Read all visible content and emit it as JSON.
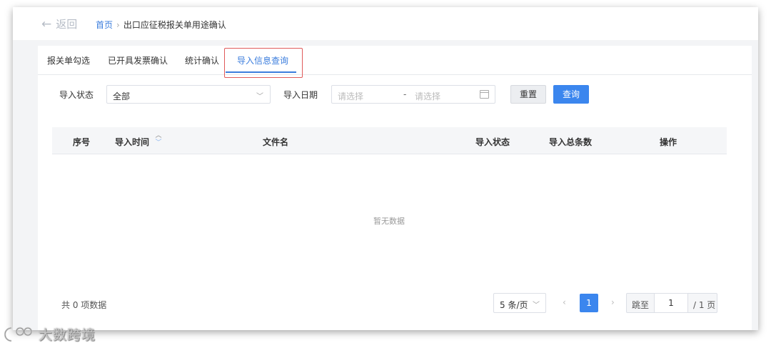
{
  "header": {
    "back_label": "返回",
    "breadcrumb": {
      "home": "首页",
      "separator": "›",
      "current": "出口应征税报关单用途确认"
    }
  },
  "tabs": [
    {
      "label": "报关单勾选"
    },
    {
      "label": "已开具发票确认"
    },
    {
      "label": "统计确认"
    },
    {
      "label": "导入信息查询"
    }
  ],
  "filters": {
    "status_label": "导入状态",
    "status_value": "全部",
    "date_label": "导入日期",
    "date_start_placeholder": "请选择",
    "date_separator": "-",
    "date_end_placeholder": "请选择",
    "reset_label": "重置",
    "query_label": "查询"
  },
  "table": {
    "columns": [
      "序号",
      "导入时间",
      "文件名",
      "导入状态",
      "导入总条数",
      "操作"
    ],
    "empty_text": "暂无数据"
  },
  "pagination": {
    "total_text": "共 0 项数据",
    "page_size": "5 条/页",
    "prev": "‹",
    "current_page": "1",
    "next": "›",
    "jump_label": "跳至",
    "jump_value": "1",
    "total_pages": "/ 1 页"
  },
  "watermark": {
    "text": "大数跨境"
  },
  "colors": {
    "accent": "#3b86ee",
    "highlight_box": "#e05a5a",
    "link": "#3b7ddd"
  }
}
